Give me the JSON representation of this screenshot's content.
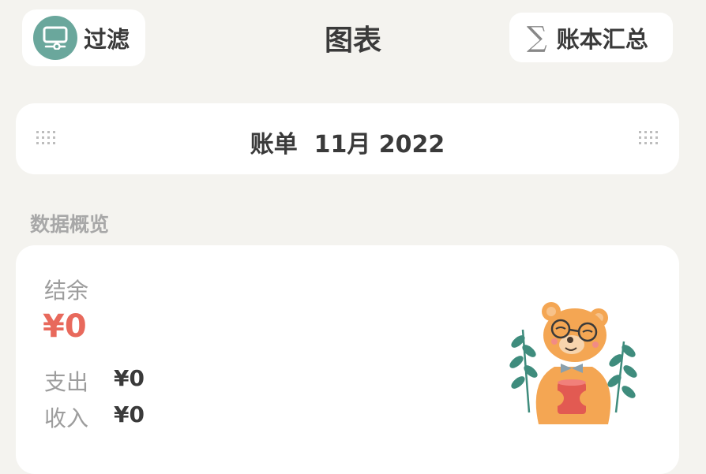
{
  "header": {
    "filter_label": "过滤",
    "title": "图表",
    "summary_label": "账本汇总",
    "summary_symbol": "∑"
  },
  "period": {
    "text": "账单  11月 2022"
  },
  "overview": {
    "section_label": "数据概览",
    "balance_label": "结余",
    "balance_value": "¥0",
    "expense_label": "支出",
    "expense_value": "¥0",
    "income_label": "收入",
    "income_value": "¥0"
  },
  "colors": {
    "accent_green": "#6aa79c",
    "balance_red": "#e8695c",
    "background": "#f4f3ef"
  },
  "icons": {
    "filter": "monitor-filter-icon",
    "summary": "sigma-icon",
    "grip": "grid-dots-icon",
    "illustration": "bear-illustration"
  }
}
